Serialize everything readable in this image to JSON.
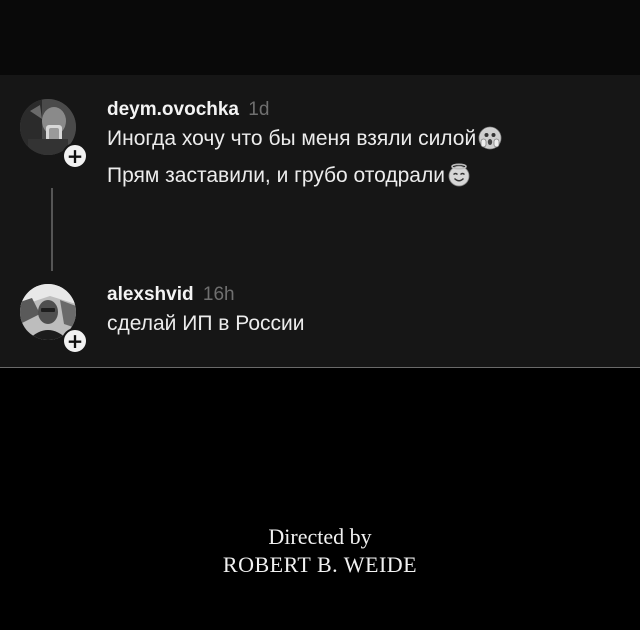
{
  "thread": {
    "posts": [
      {
        "username": "deym.ovochka",
        "time": "1d",
        "lines": [
          "Иногда хочу что бы меня взяли силой",
          "Прям заставили, и грубо отодрали"
        ],
        "line_emojis": [
          "screaming-face-emoji",
          "smiling-face-with-halo-emoji"
        ],
        "follow_icon": "plus-icon"
      },
      {
        "username": "alexshvid",
        "time": "16h",
        "lines": [
          "сделай ИП в России"
        ],
        "follow_icon": "plus-icon"
      }
    ]
  },
  "credits": {
    "line1": "Directed by",
    "line2": "ROBERT B. WEIDE"
  },
  "colors": {
    "background": "#000000",
    "card": "#161616",
    "username": "#f3f3f3",
    "timestamp": "#6f6f6f",
    "text": "#ececec"
  }
}
